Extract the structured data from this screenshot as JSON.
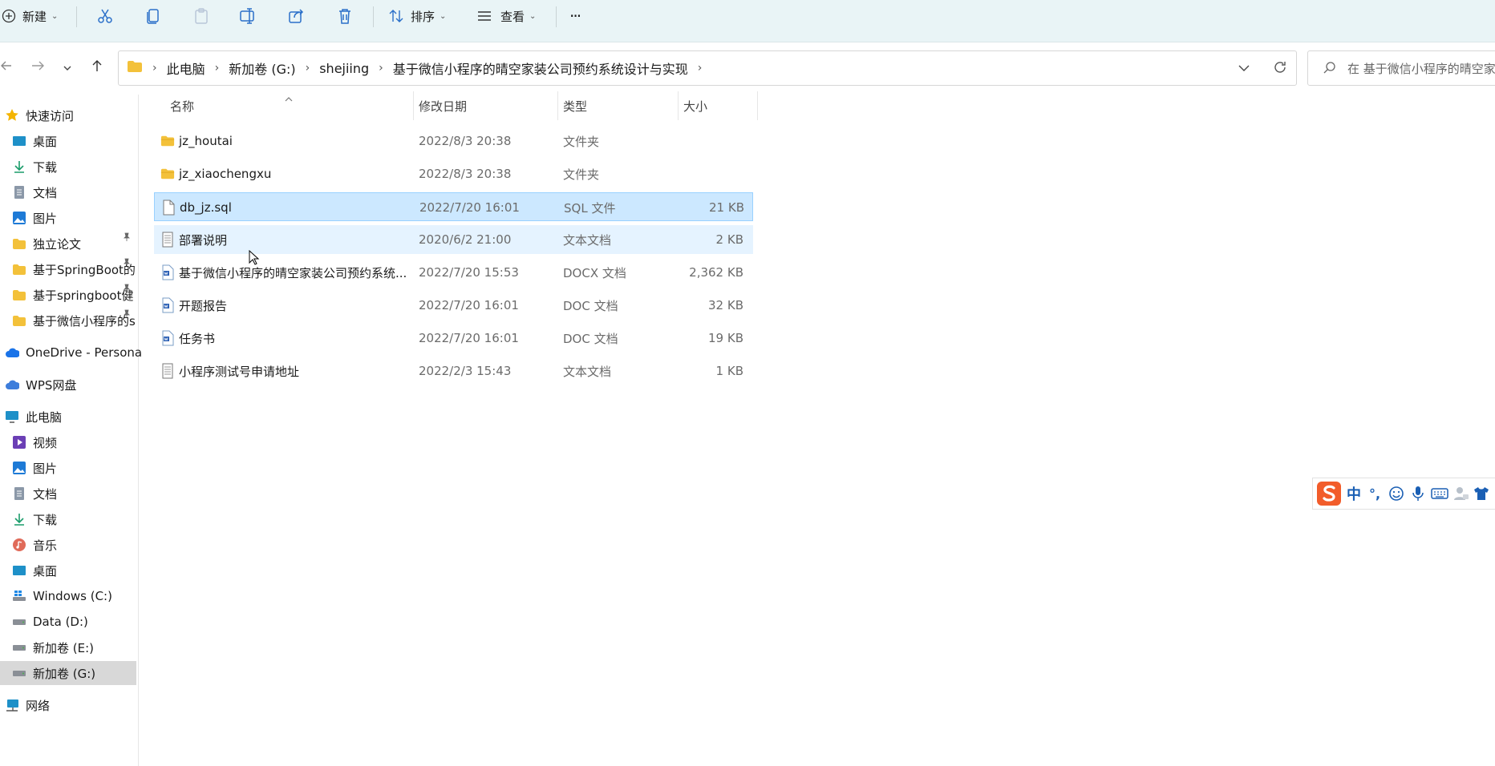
{
  "toolbar": {
    "new_label": "新建",
    "sort_label": "排序",
    "view_label": "查看",
    "more_label": "···"
  },
  "breadcrumb": [
    "此电脑",
    "新加卷 (G:)",
    "shejiing",
    "基于微信小程序的晴空家装公司预约系统设计与实现"
  ],
  "search": {
    "placeholder": "在 基于微信小程序的晴空家装..."
  },
  "sidebar": {
    "quick_access": "快速访问",
    "quick_items": [
      {
        "label": "桌面",
        "icon": "desktop-icon",
        "pinned": true
      },
      {
        "label": "下载",
        "icon": "download-icon",
        "pinned": true
      },
      {
        "label": "文档",
        "icon": "documents-icon",
        "pinned": true
      },
      {
        "label": "图片",
        "icon": "pictures-icon",
        "pinned": true
      },
      {
        "label": "独立论文",
        "icon": "folder-icon",
        "pinned": false
      },
      {
        "label": "基于SpringBoot的",
        "icon": "folder-icon",
        "pinned": false
      },
      {
        "label": "基于springboot健",
        "icon": "folder-icon",
        "pinned": false
      },
      {
        "label": "基于微信小程序的s",
        "icon": "folder-icon",
        "pinned": false
      }
    ],
    "onedrive": "OneDrive - Persona",
    "wps": "WPS网盘",
    "this_pc": "此电脑",
    "pc_items": [
      {
        "label": "视频",
        "icon": "videos-icon"
      },
      {
        "label": "图片",
        "icon": "pictures-icon"
      },
      {
        "label": "文档",
        "icon": "documents-icon"
      },
      {
        "label": "下载",
        "icon": "download-icon"
      },
      {
        "label": "音乐",
        "icon": "music-icon"
      },
      {
        "label": "桌面",
        "icon": "desktop-icon"
      },
      {
        "label": "Windows (C:)",
        "icon": "windows-drive-icon"
      },
      {
        "label": "Data (D:)",
        "icon": "drive-icon"
      },
      {
        "label": "新加卷 (E:)",
        "icon": "drive-icon"
      },
      {
        "label": "新加卷 (G:)",
        "icon": "drive-icon"
      }
    ],
    "network": "网络"
  },
  "columns": {
    "name": "名称",
    "date": "修改日期",
    "type": "类型",
    "size": "大小"
  },
  "files": [
    {
      "name": "jz_houtai",
      "date": "2022/8/3 20:38",
      "type": "文件夹",
      "size": "",
      "icon": "folder-icon"
    },
    {
      "name": "jz_xiaochengxu",
      "date": "2022/8/3 20:38",
      "type": "文件夹",
      "size": "",
      "icon": "folder-icon"
    },
    {
      "name": "db_jz.sql",
      "date": "2022/7/20 16:01",
      "type": "SQL 文件",
      "size": "21 KB",
      "icon": "file-icon",
      "selected": true
    },
    {
      "name": "部署说明",
      "date": "2020/6/2 21:00",
      "type": "文本文档",
      "size": "2 KB",
      "icon": "text-file-icon",
      "hover": true
    },
    {
      "name": "基于微信小程序的晴空家装公司预约系统...",
      "date": "2022/7/20 15:53",
      "type": "DOCX 文档",
      "size": "2,362 KB",
      "icon": "word-doc-icon"
    },
    {
      "name": "开题报告",
      "date": "2022/7/20 16:01",
      "type": "DOC 文档",
      "size": "32 KB",
      "icon": "word-doc-icon"
    },
    {
      "name": "任务书",
      "date": "2022/7/20 16:01",
      "type": "DOC 文档",
      "size": "19 KB",
      "icon": "word-doc-icon"
    },
    {
      "name": "小程序测试号申请地址",
      "date": "2022/2/3 15:43",
      "type": "文本文档",
      "size": "1 KB",
      "icon": "text-file-icon"
    }
  ],
  "ime": {
    "lang": "中",
    "punct": "°,"
  },
  "colors": {
    "accent": "#0078d4",
    "selection": "#cce8ff",
    "folder": "#f3c13a",
    "toolbar_bg": "#e9f4f6"
  }
}
